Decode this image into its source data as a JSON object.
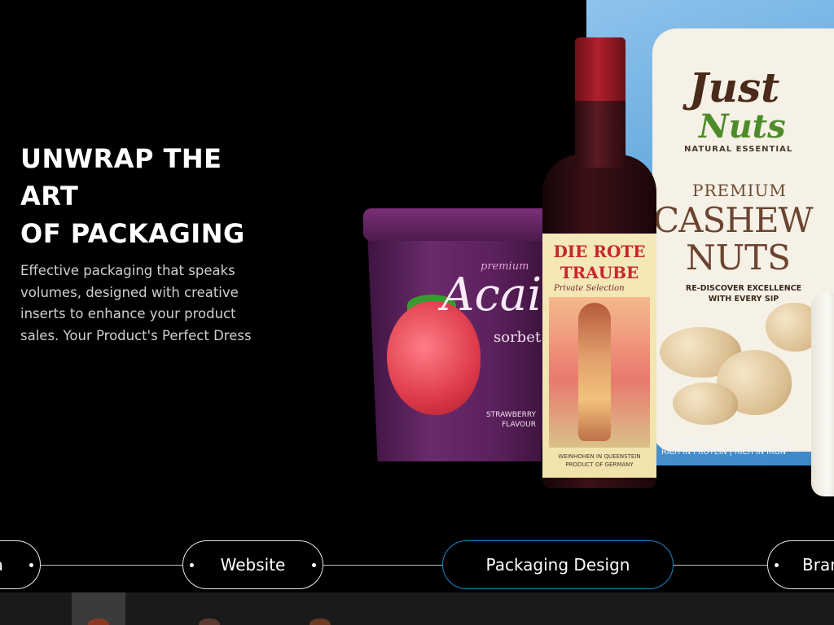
{
  "hero": {
    "title": "UNWRAP THE ART\nOF PACKAGING",
    "description": "Effective packaging that speaks volumes, designed with creative inserts to enhance your product sales. Your Product's Perfect Dress"
  },
  "products": {
    "nuts_pouch": {
      "brand_top": "Just",
      "brand_bottom": "Nuts",
      "subtitle": "NATURAL ESSENTIAL",
      "premium": "PREMIUM",
      "name_line1": "CASHEW",
      "name_line2": "NUTS",
      "tagline": "RE-DISCOVER EXCELLENCE\nWITH EVERY SIP",
      "footer": "NO TRANS FAT | NO CHOLESTERO\nRICH IN PROTEIN | RICH IN IRON"
    },
    "ice_cream": {
      "premium": "premium",
      "name": "Acai",
      "sub": "sorbet",
      "flavour": "STRAWBERRY\nFLAVOUR"
    },
    "wine": {
      "title": "DIE ROTE\nTRAUBE",
      "script": "Private Selection",
      "footer": "WEINHOHEN IN QUEENSTEIN\nPRODUCT OF GERMANY"
    }
  },
  "categories": {
    "items": [
      {
        "label": "a"
      },
      {
        "label": "Website"
      },
      {
        "label": "Packaging Design"
      },
      {
        "label": "Bran"
      }
    ],
    "active": "Packaging Design"
  },
  "colors": {
    "background": "#000000",
    "active_pill_border": "#1f86c9",
    "pill_border": "#e6e6e6"
  }
}
